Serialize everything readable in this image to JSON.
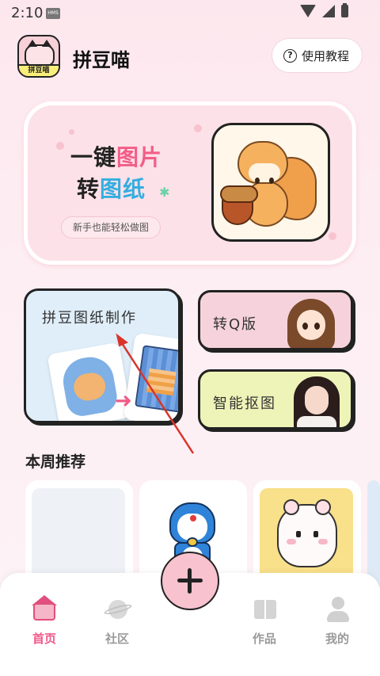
{
  "status_bar": {
    "time": "2:10",
    "badge": "HMS"
  },
  "header": {
    "app_title": "拼豆喵",
    "logo_text": "拼豆喵",
    "tutorial_label": "使用教程"
  },
  "hero": {
    "line1_prefix": "一键",
    "line1_highlight": "图片",
    "line2_prefix": "转",
    "line2_highlight": "图纸",
    "subtitle": "新手也能轻松做图"
  },
  "features": {
    "main_title": "拼豆图纸制作",
    "q_title": "转Q版",
    "cutout_title": "智能抠图"
  },
  "weekly": {
    "title": "本周推荐"
  },
  "nav": {
    "home": "首页",
    "community": "社区",
    "works": "作品",
    "mine": "我的"
  },
  "colors": {
    "accent": "#f0598a",
    "hero_bg": "#fde1e8",
    "main_card_bg": "#dfeef9",
    "q_card_bg": "#f6d3dc",
    "cutout_card_bg": "#eef4b8",
    "annotation_arrow": "#d9342b"
  },
  "icons": [
    "wifi-icon",
    "cellular-icon",
    "battery-icon",
    "help-icon",
    "home-icon",
    "community-icon",
    "works-icon",
    "profile-icon",
    "plus-icon"
  ]
}
